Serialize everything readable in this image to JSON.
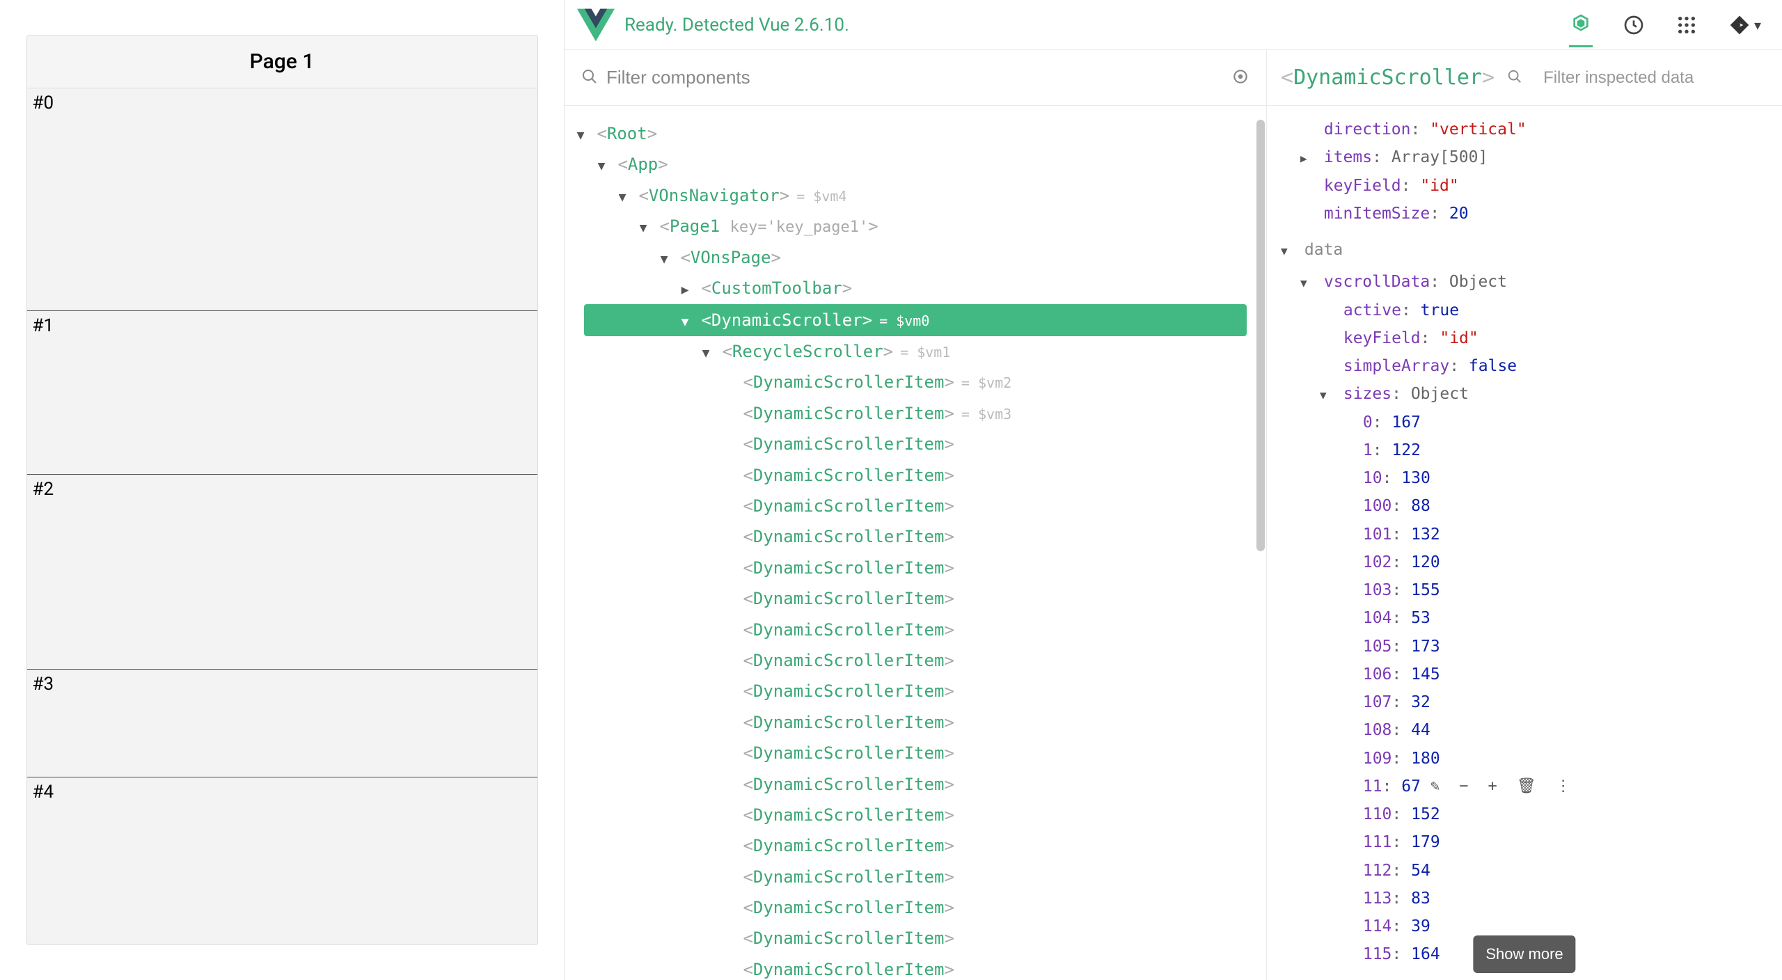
{
  "header": {
    "status": "Ready. Detected Vue 2.6.10."
  },
  "preview": {
    "title": "Page 1",
    "items": [
      "#0",
      "#1",
      "#2",
      "#3",
      "#4"
    ]
  },
  "tree": {
    "filter_placeholder": "Filter components",
    "nodes": [
      {
        "indent": 0,
        "arrow": "down",
        "name": "Root",
        "suffix": ""
      },
      {
        "indent": 1,
        "arrow": "down",
        "name": "App",
        "suffix": ""
      },
      {
        "indent": 2,
        "arrow": "down",
        "name": "VOnsNavigator",
        "suffix": "= $vm4"
      },
      {
        "indent": 3,
        "arrow": "down",
        "name": "Page1",
        "key": "key='key_page1'",
        "suffix": ""
      },
      {
        "indent": 4,
        "arrow": "down",
        "name": "VOnsPage",
        "suffix": ""
      },
      {
        "indent": 5,
        "arrow": "right",
        "name": "CustomToolbar",
        "suffix": ""
      },
      {
        "indent": 5,
        "arrow": "down",
        "name": "DynamicScroller",
        "suffix": "= $vm0",
        "selected": true
      },
      {
        "indent": 6,
        "arrow": "down",
        "name": "RecycleScroller",
        "suffix": "= $vm1"
      },
      {
        "indent": 7,
        "arrow": "none",
        "name": "DynamicScrollerItem",
        "suffix": "= $vm2"
      },
      {
        "indent": 7,
        "arrow": "none",
        "name": "DynamicScrollerItem",
        "suffix": "= $vm3"
      },
      {
        "indent": 7,
        "arrow": "none",
        "name": "DynamicScrollerItem",
        "suffix": ""
      },
      {
        "indent": 7,
        "arrow": "none",
        "name": "DynamicScrollerItem",
        "suffix": ""
      },
      {
        "indent": 7,
        "arrow": "none",
        "name": "DynamicScrollerItem",
        "suffix": ""
      },
      {
        "indent": 7,
        "arrow": "none",
        "name": "DynamicScrollerItem",
        "suffix": ""
      },
      {
        "indent": 7,
        "arrow": "none",
        "name": "DynamicScrollerItem",
        "suffix": ""
      },
      {
        "indent": 7,
        "arrow": "none",
        "name": "DynamicScrollerItem",
        "suffix": ""
      },
      {
        "indent": 7,
        "arrow": "none",
        "name": "DynamicScrollerItem",
        "suffix": ""
      },
      {
        "indent": 7,
        "arrow": "none",
        "name": "DynamicScrollerItem",
        "suffix": ""
      },
      {
        "indent": 7,
        "arrow": "none",
        "name": "DynamicScrollerItem",
        "suffix": ""
      },
      {
        "indent": 7,
        "arrow": "none",
        "name": "DynamicScrollerItem",
        "suffix": ""
      },
      {
        "indent": 7,
        "arrow": "none",
        "name": "DynamicScrollerItem",
        "suffix": ""
      },
      {
        "indent": 7,
        "arrow": "none",
        "name": "DynamicScrollerItem",
        "suffix": ""
      },
      {
        "indent": 7,
        "arrow": "none",
        "name": "DynamicScrollerItem",
        "suffix": ""
      },
      {
        "indent": 7,
        "arrow": "none",
        "name": "DynamicScrollerItem",
        "suffix": ""
      },
      {
        "indent": 7,
        "arrow": "none",
        "name": "DynamicScrollerItem",
        "suffix": ""
      },
      {
        "indent": 7,
        "arrow": "none",
        "name": "DynamicScrollerItem",
        "suffix": ""
      },
      {
        "indent": 7,
        "arrow": "none",
        "name": "DynamicScrollerItem",
        "suffix": ""
      },
      {
        "indent": 7,
        "arrow": "none",
        "name": "DynamicScrollerItem",
        "suffix": ""
      }
    ]
  },
  "inspector": {
    "title": "DynamicScroller",
    "filter_placeholder": "Filter inspected data",
    "props": [
      {
        "indent": 1,
        "arrow": "blank",
        "key": "direction",
        "value": "\"vertical\"",
        "vclass": "v-str"
      },
      {
        "indent": 1,
        "arrow": "right",
        "key": "items",
        "value": "Array[500]",
        "vclass": "v-type"
      },
      {
        "indent": 1,
        "arrow": "blank",
        "key": "keyField",
        "value": "\"id\"",
        "vclass": "v-str"
      },
      {
        "indent": 1,
        "arrow": "blank",
        "key": "minItemSize",
        "value": "20",
        "vclass": "v-lit"
      }
    ],
    "data_section": "data",
    "data_rows": [
      {
        "indent": 1,
        "arrow": "down",
        "key": "vscrollData",
        "value": "Object",
        "vclass": "v-type"
      },
      {
        "indent": 2,
        "arrow": "blank",
        "key": "active",
        "value": "true",
        "vclass": "v-lit"
      },
      {
        "indent": 2,
        "arrow": "blank",
        "key": "keyField",
        "value": "\"id\"",
        "vclass": "v-str"
      },
      {
        "indent": 2,
        "arrow": "blank",
        "key": "simpleArray",
        "value": "false",
        "vclass": "v-lit"
      },
      {
        "indent": 2,
        "arrow": "down",
        "key": "sizes",
        "value": "Object",
        "vclass": "v-type"
      },
      {
        "indent": 3,
        "arrow": "blank",
        "key": "0",
        "value": "167",
        "vclass": "v-lit"
      },
      {
        "indent": 3,
        "arrow": "blank",
        "key": "1",
        "value": "122",
        "vclass": "v-lit"
      },
      {
        "indent": 3,
        "arrow": "blank",
        "key": "10",
        "value": "130",
        "vclass": "v-lit"
      },
      {
        "indent": 3,
        "arrow": "blank",
        "key": "100",
        "value": "88",
        "vclass": "v-lit"
      },
      {
        "indent": 3,
        "arrow": "blank",
        "key": "101",
        "value": "132",
        "vclass": "v-lit"
      },
      {
        "indent": 3,
        "arrow": "blank",
        "key": "102",
        "value": "120",
        "vclass": "v-lit"
      },
      {
        "indent": 3,
        "arrow": "blank",
        "key": "103",
        "value": "155",
        "vclass": "v-lit"
      },
      {
        "indent": 3,
        "arrow": "blank",
        "key": "104",
        "value": "53",
        "vclass": "v-lit"
      },
      {
        "indent": 3,
        "arrow": "blank",
        "key": "105",
        "value": "173",
        "vclass": "v-lit"
      },
      {
        "indent": 3,
        "arrow": "blank",
        "key": "106",
        "value": "145",
        "vclass": "v-lit"
      },
      {
        "indent": 3,
        "arrow": "blank",
        "key": "107",
        "value": "32",
        "vclass": "v-lit"
      },
      {
        "indent": 3,
        "arrow": "blank",
        "key": "108",
        "value": "44",
        "vclass": "v-lit"
      },
      {
        "indent": 3,
        "arrow": "blank",
        "key": "109",
        "value": "180",
        "vclass": "v-lit"
      },
      {
        "indent": 3,
        "arrow": "blank",
        "key": "11",
        "value": "67",
        "vclass": "v-lit",
        "actions": true
      },
      {
        "indent": 3,
        "arrow": "blank",
        "key": "110",
        "value": "152",
        "vclass": "v-lit"
      },
      {
        "indent": 3,
        "arrow": "blank",
        "key": "111",
        "value": "179",
        "vclass": "v-lit"
      },
      {
        "indent": 3,
        "arrow": "blank",
        "key": "112",
        "value": "54",
        "vclass": "v-lit"
      },
      {
        "indent": 3,
        "arrow": "blank",
        "key": "113",
        "value": "83",
        "vclass": "v-lit"
      },
      {
        "indent": 3,
        "arrow": "blank",
        "key": "114",
        "value": "39",
        "vclass": "v-lit"
      },
      {
        "indent": 3,
        "arrow": "blank",
        "key": "115",
        "value": "164",
        "vclass": "v-lit"
      }
    ],
    "show_more": "Show more"
  }
}
